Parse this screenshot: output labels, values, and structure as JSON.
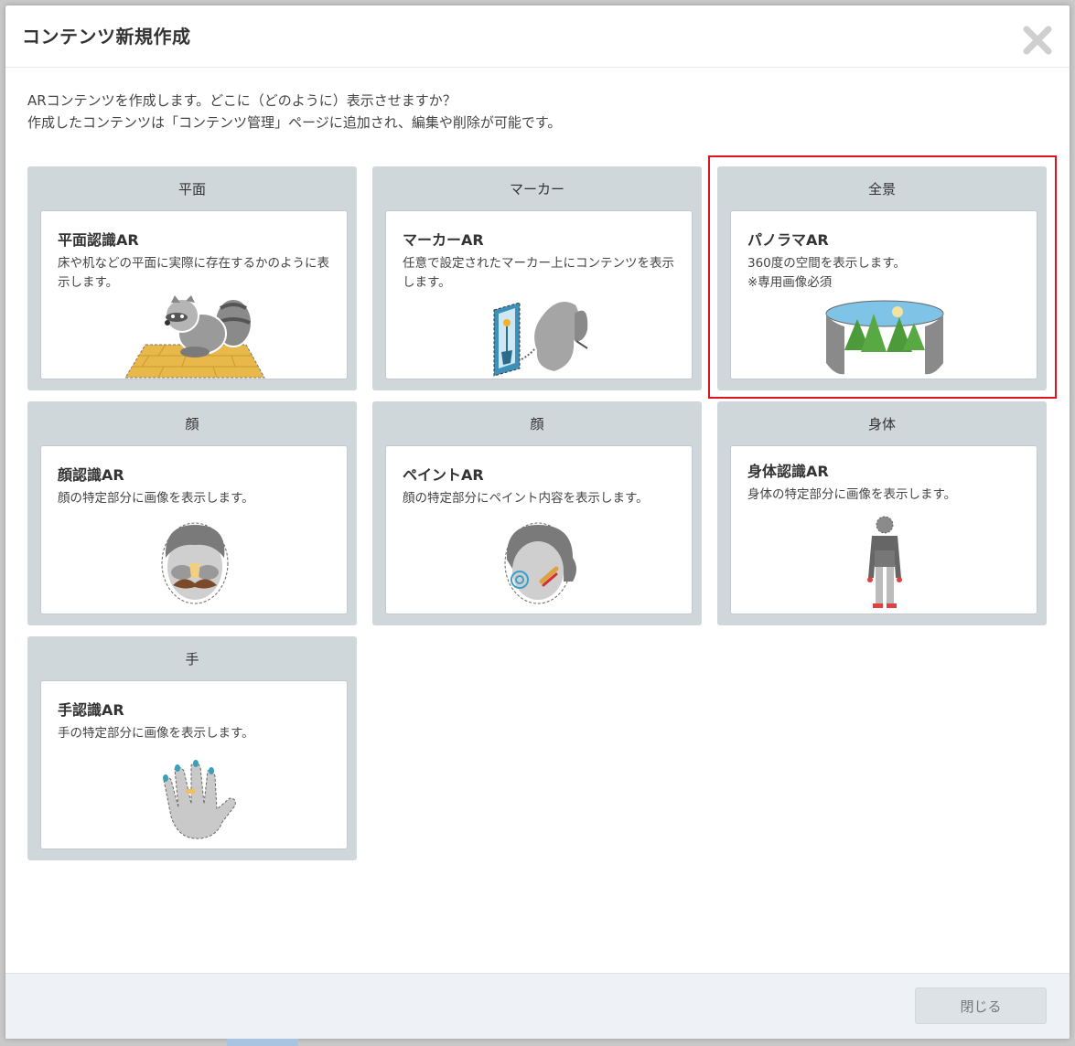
{
  "modal": {
    "title": "コンテンツ新規作成",
    "close_icon": "close-x-icon",
    "intro_line1": "ARコンテンツを作成します。どこに（どのように）表示させますか？",
    "intro_line2": "作成したコンテンツは「コンテンツ管理」ページに追加され、編集や削除が可能です。",
    "close_button_label": "閉じる",
    "highlight_color": "#e0141e"
  },
  "cards": [
    {
      "category": "平面",
      "name": "平面認識AR",
      "description": "床や机などの平面に実際に存在するかのように表示します。",
      "icon": "raccoon-on-floor-icon"
    },
    {
      "category": "マーカー",
      "name": "マーカーAR",
      "description": "任意で設定されたマーカー上にコンテンツを表示します。",
      "icon": "marker-butterfly-icon"
    },
    {
      "category": "全景",
      "name": "パノラマAR",
      "description": "360度の空間を表示します。",
      "note": "※専用画像必須",
      "icon": "panorama-forest-icon"
    },
    {
      "category": "顔",
      "name": "顔認識AR",
      "description": "顔の特定部分に画像を表示します。",
      "icon": "face-mustache-icon"
    },
    {
      "category": "顔",
      "name": "ペイントAR",
      "description": "顔の特定部分にペイント内容を表示します。",
      "icon": "face-paint-icon"
    },
    {
      "category": "身体",
      "name": "身体認識AR",
      "description": "身体の特定部分に画像を表示します。",
      "icon": "body-figure-icon"
    },
    {
      "category": "手",
      "name": "手認識AR",
      "description": "手の特定部分に画像を表示します。",
      "icon": "hand-icon"
    }
  ]
}
